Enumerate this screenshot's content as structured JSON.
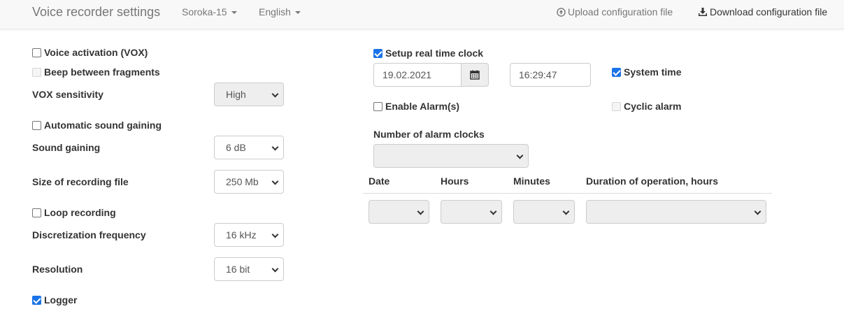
{
  "nav": {
    "brand": "Voice recorder settings",
    "device": "Soroka-15",
    "language": "English",
    "upload": "Upload configuration file",
    "download": "Download configuration file"
  },
  "left": {
    "vox": "Voice activation (VOX)",
    "beep": "Beep between fragments",
    "vox_sensitivity_label": "VOX sensitivity",
    "vox_sensitivity_value": "High",
    "auto_gain": "Automatic sound gaining",
    "sound_gaining_label": "Sound gaining",
    "sound_gaining_value": "6 dB",
    "file_size_label": "Size of recording file",
    "file_size_value": "250 Mb",
    "loop": "Loop recording",
    "freq_label": "Discretization frequency",
    "freq_value": "16 kHz",
    "resolution_label": "Resolution",
    "resolution_value": "16 bit",
    "logger": "Logger"
  },
  "right": {
    "rtc": "Setup real time clock",
    "date": "19.02.2021",
    "time": "16:29:47",
    "system_time": "System time",
    "enable_alarms": "Enable Alarm(s)",
    "cyclic_alarm": "Cyclic alarm",
    "alarm_count_label": "Number of alarm clocks",
    "alarm_count_value": "",
    "table_headers": [
      "Date",
      "Hours",
      "Minutes",
      "Duration of operation, hours"
    ]
  },
  "state": {
    "vox": false,
    "beep": false,
    "auto_gain": false,
    "loop": false,
    "logger": true,
    "rtc": true,
    "system_time": true,
    "enable_alarms": false,
    "cyclic_alarm": false
  },
  "icons": {
    "upload": "upload-circle-icon",
    "download": "download-icon",
    "calendar": "calendar-icon"
  },
  "colors": {
    "checkbox_accent": "#1a73e8",
    "navbar_bg": "#f8f8f8"
  }
}
